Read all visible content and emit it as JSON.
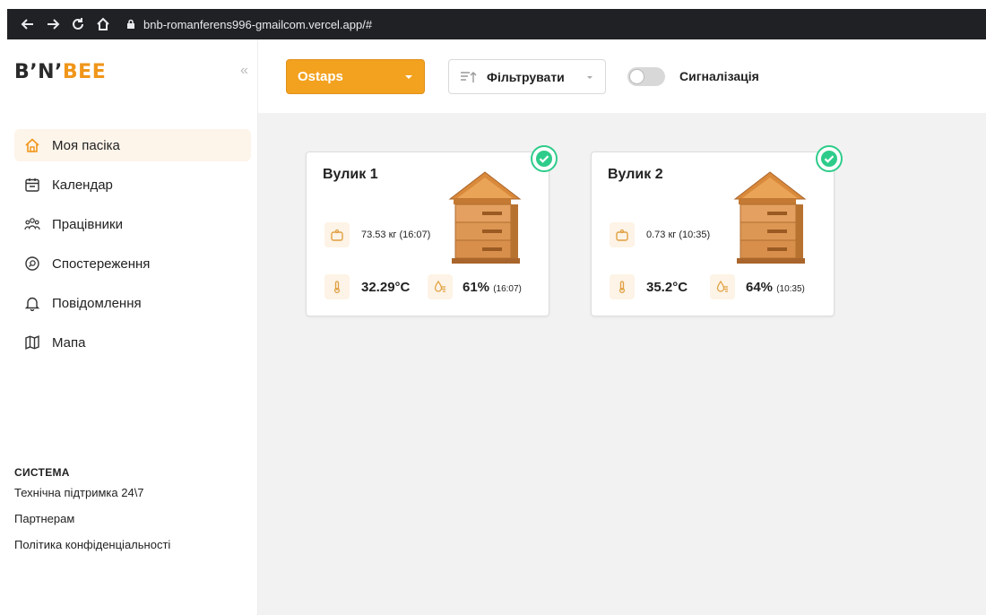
{
  "browser": {
    "url": "bnb-romanferens996-gmailcom.vercel.app/#"
  },
  "sidebar": {
    "logo_part1": "B’N’",
    "logo_part2": "BEE",
    "collapse_glyph": "«",
    "nav": [
      {
        "label": "Моя пасіка",
        "icon": "home-icon"
      },
      {
        "label": "Календар",
        "icon": "calendar-icon"
      },
      {
        "label": "Працівники",
        "icon": "people-icon"
      },
      {
        "label": "Спостереження",
        "icon": "observation-icon"
      },
      {
        "label": "Повідомлення",
        "icon": "bell-icon"
      },
      {
        "label": "Мапа",
        "icon": "map-icon"
      }
    ],
    "system_heading": "СИСТЕМА",
    "system_links": [
      "Технічна підтримка 24\\7",
      "Партнерам",
      "Політика конфіденціальності"
    ]
  },
  "toolbar": {
    "apiary_value": "Ostaps",
    "filter_label": "Фільтрувати",
    "alarm_label": "Сигналізація",
    "alarm_on": false
  },
  "hives": [
    {
      "name": "Вулик 1",
      "weight": "73.53 кг (16:07)",
      "temperature": "32.29°C",
      "humidity": "61%",
      "humidity_time": "(16:07)",
      "status": "ok"
    },
    {
      "name": "Вулик 2",
      "weight": "0.73 кг (10:35)",
      "temperature": "35.2°C",
      "humidity": "64%",
      "humidity_time": "(10:35)",
      "status": "ok"
    }
  ],
  "colors": {
    "accent": "#f3a21f",
    "status_ok": "#2ecc8a"
  }
}
